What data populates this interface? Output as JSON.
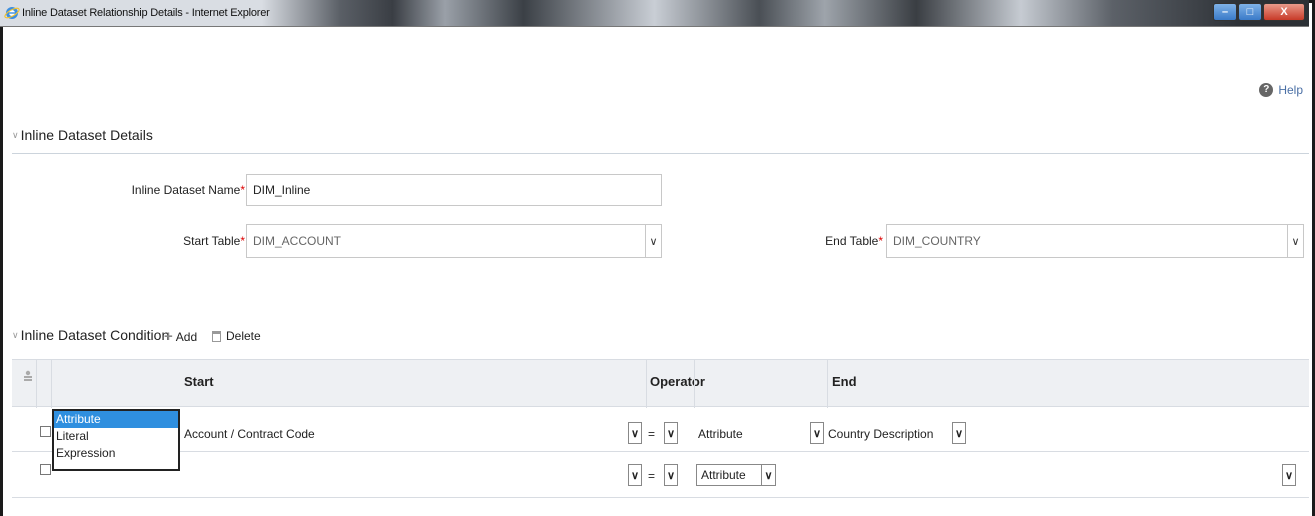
{
  "window": {
    "title": "Inline Dataset Relationship Details - Internet Explorer",
    "controls": {
      "minimize": "–",
      "maximize": "□",
      "close": "X"
    }
  },
  "help": {
    "label": "Help",
    "icon": "?"
  },
  "details_section": {
    "title": "Inline Dataset Details",
    "name_label": "Inline Dataset Name",
    "name_value": "DIM_Inline",
    "start_table_label": "Start Table",
    "start_table_value": "DIM_ACCOUNT",
    "end_table_label": "End Table",
    "end_table_value": "DIM_COUNTRY",
    "required_mark": "*"
  },
  "condition_section": {
    "title": "Inline Dataset Condition",
    "add_label": "Add",
    "delete_label": "Delete"
  },
  "grid": {
    "headers": {
      "start": "Start",
      "operator": "Operator",
      "end": "End"
    },
    "rows": [
      {
        "start_type": "Attribute",
        "start_value": "Account / Contract Code",
        "operator": "=",
        "end_type": "Attribute",
        "end_value": "Country Description"
      },
      {
        "start_type": "",
        "start_value": "",
        "operator": "=",
        "end_type": "Attribute",
        "end_value": ""
      }
    ]
  },
  "open_dropdown": {
    "options": [
      "Attribute",
      "Literal",
      "Expression"
    ],
    "selected": "Attribute"
  },
  "colors": {
    "accent": "#2f8fdf",
    "link": "#4a6fa5",
    "required": "#dd0000"
  }
}
